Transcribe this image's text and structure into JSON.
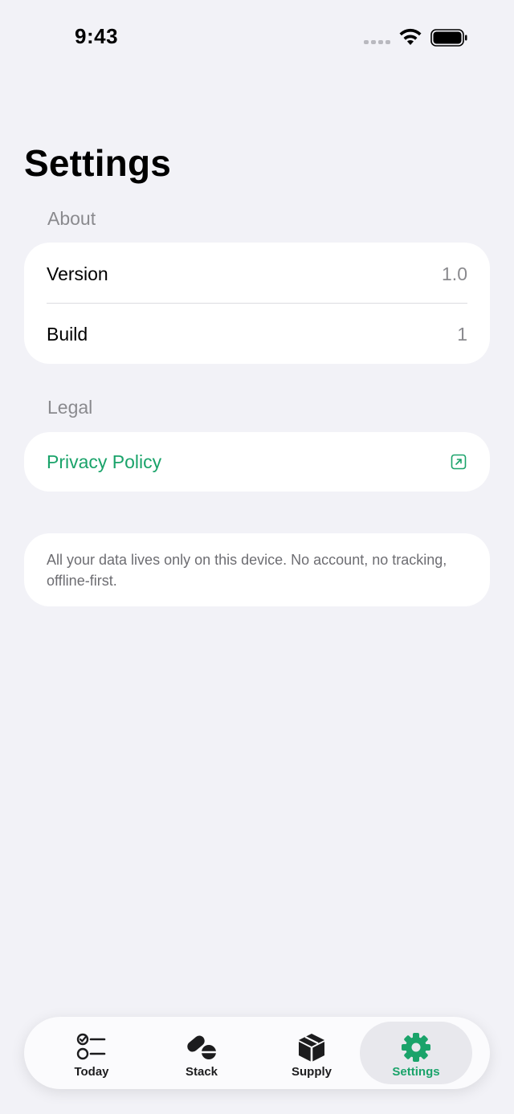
{
  "status_bar": {
    "time": "9:43"
  },
  "title": "Settings",
  "sections": {
    "about": {
      "header": "About",
      "rows": [
        {
          "label": "Version",
          "value": "1.0"
        },
        {
          "label": "Build",
          "value": "1"
        }
      ]
    },
    "legal": {
      "header": "Legal",
      "privacy_label": "Privacy Policy",
      "privacy_icon": "external-link-icon"
    },
    "note": "All your data lives only on this device. No account, no tracking, offline-first."
  },
  "tab_bar": {
    "tabs": [
      {
        "label": "Today",
        "icon": "checklist-icon",
        "selected": false
      },
      {
        "label": "Stack",
        "icon": "pills-icon",
        "selected": false
      },
      {
        "label": "Supply",
        "icon": "box-icon",
        "selected": false
      },
      {
        "label": "Settings",
        "icon": "gear-icon",
        "selected": true
      }
    ]
  },
  "colors": {
    "accent": "#1aa36a",
    "background": "#f2f2f7",
    "secondary_text": "#8a8a8e"
  }
}
